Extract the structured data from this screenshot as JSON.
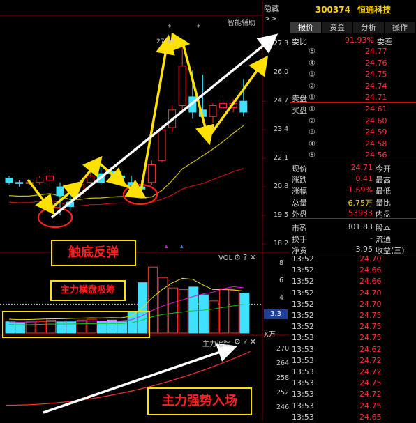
{
  "stock": {
    "code": "300374",
    "name": "恒通科技"
  },
  "header": {
    "hide_label": "隐藏>>",
    "assist_label": "智能辅助"
  },
  "tabs": [
    {
      "label": "报价",
      "active": true
    },
    {
      "label": "资金",
      "active": false
    },
    {
      "label": "分析",
      "active": false
    },
    {
      "label": "操作",
      "active": false
    }
  ],
  "orderbook": {
    "ratio_label": "委比",
    "ratio_value": "91.93%",
    "diff_label": "委差",
    "sell_label": "卖盘",
    "buy_label": "买盘",
    "asks": [
      {
        "level": "⑤",
        "price": "24.77"
      },
      {
        "level": "④",
        "price": "24.76"
      },
      {
        "level": "③",
        "price": "24.75"
      },
      {
        "level": "②",
        "price": "24.74"
      },
      {
        "level": "①",
        "price": "24.71"
      }
    ],
    "bids": [
      {
        "level": "①",
        "price": "24.61"
      },
      {
        "level": "②",
        "price": "24.60"
      },
      {
        "level": "③",
        "price": "24.59"
      },
      {
        "level": "④",
        "price": "24.58"
      },
      {
        "level": "⑤",
        "price": "24.56"
      }
    ]
  },
  "quote": [
    {
      "label": "现价",
      "value": "24.71",
      "label2": "今开",
      "color": "red"
    },
    {
      "label": "涨跌",
      "value": "0.41",
      "label2": "最高",
      "color": "red"
    },
    {
      "label": "涨幅",
      "value": "1.69%",
      "label2": "最低",
      "color": "red"
    },
    {
      "label": "总量",
      "value": "6.75万",
      "label2": "量比",
      "color": "yellow"
    },
    {
      "label": "外盘",
      "value": "53933",
      "label2": "内盘",
      "color": "red"
    },
    {
      "label": "市盈",
      "value": "301.83",
      "label2": "股本",
      "color": "white"
    },
    {
      "label": "换手",
      "value": "-",
      "label2": "流通",
      "color": "white"
    },
    {
      "label": "净资",
      "value": "3.95",
      "label2": "收益(三)",
      "color": "white"
    }
  ],
  "trades": [
    {
      "time": "13:52",
      "price": "24.70"
    },
    {
      "time": "13:52",
      "price": "24.66"
    },
    {
      "time": "13:52",
      "price": "24.66"
    },
    {
      "time": "13:52",
      "price": "24.70"
    },
    {
      "time": "13:52",
      "price": "24.70"
    },
    {
      "time": "13:52",
      "price": "24.75"
    },
    {
      "time": "13:52",
      "price": "24.75"
    },
    {
      "time": "13:53",
      "price": "24.75"
    },
    {
      "time": "13:53",
      "price": "24.62"
    },
    {
      "time": "13:53",
      "price": "24.72"
    },
    {
      "time": "13:53",
      "price": "24.72"
    },
    {
      "time": "13:53",
      "price": "24.75"
    },
    {
      "time": "13:53",
      "price": "24.72"
    },
    {
      "time": "13:53",
      "price": "24.75"
    },
    {
      "time": "13:53",
      "price": "24.65"
    }
  ],
  "price_axis": [
    "27.3",
    "26.0",
    "24.7",
    "23.4",
    "22.1",
    "20.8",
    "19.5",
    "18.2"
  ],
  "peak_label": "27.49",
  "vol_panel": {
    "label": "VOL",
    "axis": [
      "8",
      "6",
      "4"
    ],
    "current": "3.3",
    "unit": "X万"
  },
  "track_panel": {
    "label": "主力追踪",
    "axis": [
      "270",
      "264",
      "258",
      "252",
      "246"
    ]
  },
  "annotations": {
    "rebound": "触底反弹",
    "accumulate": "主力横盘吸筹",
    "strong_entry": "主力强势入场"
  },
  "chart_data": {
    "type": "candlestick",
    "candles": [
      {
        "o": 21.2,
        "c": 21.0,
        "h": 21.3,
        "l": 20.9
      },
      {
        "o": 21.0,
        "c": 20.95,
        "h": 21.1,
        "l": 20.8
      },
      {
        "o": 20.95,
        "c": 21.0,
        "h": 21.05,
        "l": 20.9
      },
      {
        "o": 21.0,
        "c": 21.2,
        "h": 21.3,
        "l": 20.9
      },
      {
        "o": 21.1,
        "c": 21.3,
        "h": 21.6,
        "l": 20.8
      },
      {
        "o": 20.8,
        "c": 20.4,
        "h": 21.0,
        "l": 19.5
      },
      {
        "o": 20.1,
        "c": 19.9,
        "h": 20.5,
        "l": 19.6
      },
      {
        "o": 20.5,
        "c": 20.9,
        "h": 21.0,
        "l": 20.3
      },
      {
        "o": 21.0,
        "c": 21.3,
        "h": 21.6,
        "l": 20.8
      },
      {
        "o": 21.4,
        "c": 21.0,
        "h": 21.8,
        "l": 20.9
      },
      {
        "o": 21.5,
        "c": 21.4,
        "h": 21.7,
        "l": 21.2
      },
      {
        "o": 21.3,
        "c": 21.2,
        "h": 21.6,
        "l": 21.0
      },
      {
        "o": 21.0,
        "c": 20.8,
        "h": 21.3,
        "l": 20.6
      },
      {
        "o": 20.8,
        "c": 20.7,
        "h": 21.1,
        "l": 20.4
      },
      {
        "o": 21.0,
        "c": 21.8,
        "h": 22.0,
        "l": 20.9
      },
      {
        "o": 22.0,
        "c": 23.4,
        "h": 23.6,
        "l": 21.9
      },
      {
        "o": 23.5,
        "c": 24.3,
        "h": 24.5,
        "l": 23.3
      },
      {
        "o": 24.5,
        "c": 26.3,
        "h": 27.49,
        "l": 24.3
      },
      {
        "o": 24.9,
        "c": 24.2,
        "h": 26.1,
        "l": 23.9
      },
      {
        "o": 24.3,
        "c": 24.0,
        "h": 25.9,
        "l": 23.8
      },
      {
        "o": 24.0,
        "c": 24.5,
        "h": 24.6,
        "l": 23.7
      },
      {
        "o": 24.4,
        "c": 24.6,
        "h": 24.8,
        "l": 23.6
      },
      {
        "o": 24.4,
        "c": 24.6,
        "h": 24.8,
        "l": 24.2
      },
      {
        "o": 24.7,
        "c": 24.2,
        "h": 25.7,
        "l": 24.0
      }
    ],
    "volume": [
      1.3,
      1.2,
      1.3,
      1.4,
      1.5,
      1.3,
      1.4,
      1.5,
      1.6,
      1.4,
      1.5,
      1.3,
      2.4,
      5.8,
      7.6,
      6.4,
      5.2,
      5.0,
      5.3,
      4.4,
      3.7,
      5.1,
      4.9,
      4.6
    ],
    "ylim": [
      18.2,
      27.5
    ]
  }
}
